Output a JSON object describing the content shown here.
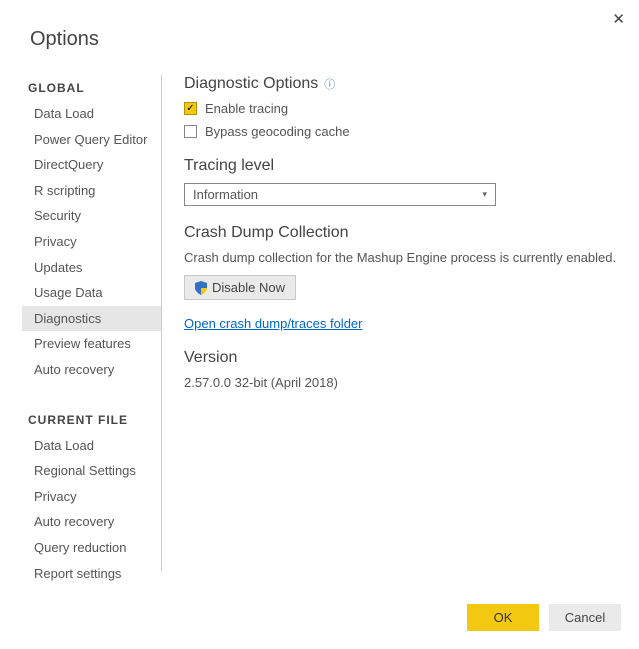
{
  "title": "Options",
  "close_glyph": "✕",
  "sidebar": {
    "sections": [
      {
        "header": "GLOBAL",
        "items": [
          {
            "label": "Data Load"
          },
          {
            "label": "Power Query Editor"
          },
          {
            "label": "DirectQuery"
          },
          {
            "label": "R scripting"
          },
          {
            "label": "Security"
          },
          {
            "label": "Privacy"
          },
          {
            "label": "Updates"
          },
          {
            "label": "Usage Data"
          },
          {
            "label": "Diagnostics",
            "selected": true
          },
          {
            "label": "Preview features"
          },
          {
            "label": "Auto recovery"
          }
        ]
      },
      {
        "header": "CURRENT FILE",
        "items": [
          {
            "label": "Data Load"
          },
          {
            "label": "Regional Settings"
          },
          {
            "label": "Privacy"
          },
          {
            "label": "Auto recovery"
          },
          {
            "label": "Query reduction"
          },
          {
            "label": "Report settings"
          }
        ]
      }
    ]
  },
  "main": {
    "diag_header": "Diagnostic Options",
    "info_glyph": "ⓘ",
    "enable_tracing": {
      "label": "Enable tracing",
      "checked": true
    },
    "bypass_geo": {
      "label": "Bypass geocoding cache",
      "checked": false
    },
    "tracing_level_header": "Tracing level",
    "tracing_level_value": "Information",
    "crash_header": "Crash Dump Collection",
    "crash_desc": "Crash dump collection for the Mashup Engine process is currently enabled.",
    "disable_btn": "Disable Now",
    "open_folder_link": "Open crash dump/traces folder",
    "version_header": "Version",
    "version_text": "2.57.0.0 32-bit (April 2018)"
  },
  "footer": {
    "ok": "OK",
    "cancel": "Cancel"
  }
}
